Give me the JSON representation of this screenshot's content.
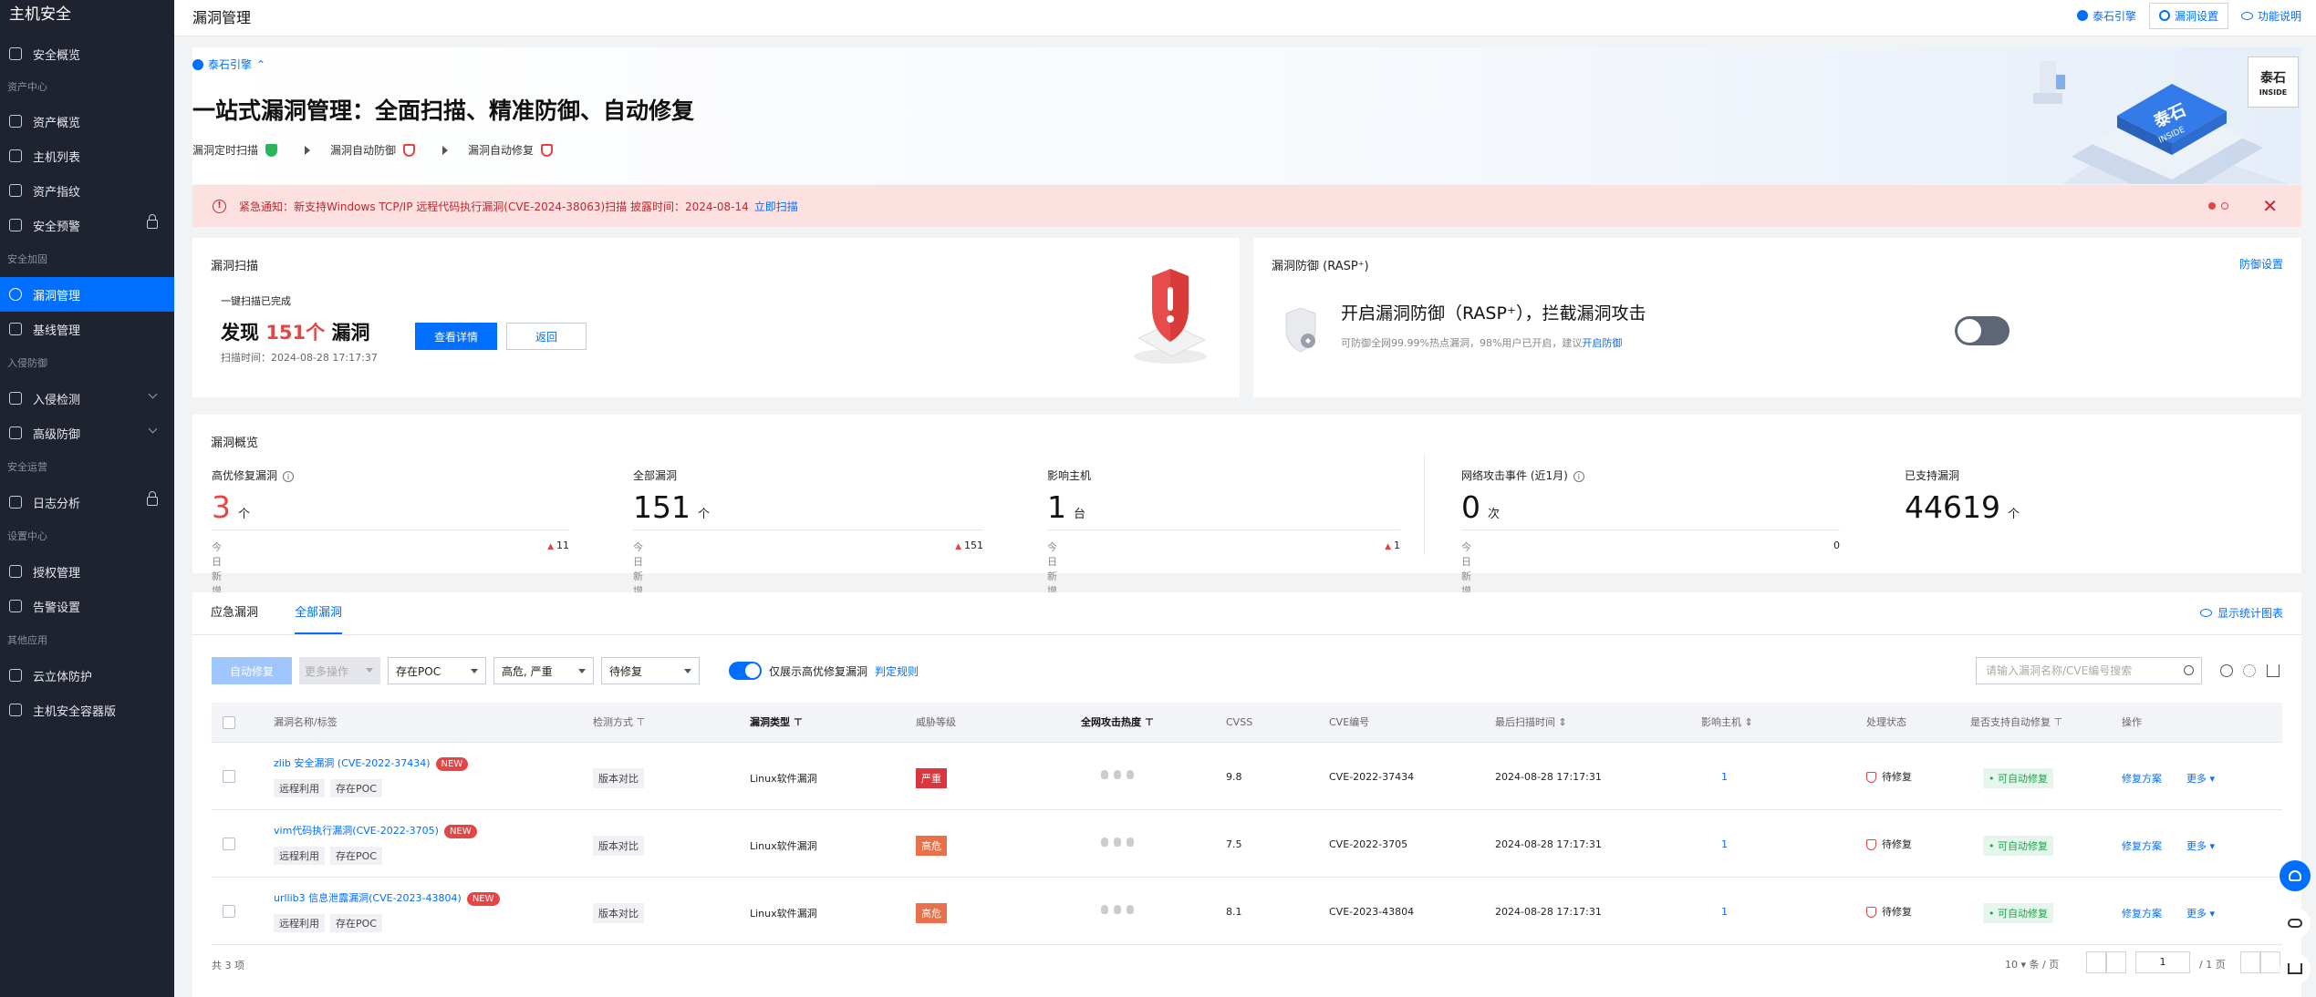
{
  "sidebar": {
    "title": "主机安全",
    "overview": "安全概览",
    "groups": {
      "asset_center": "资产中心",
      "security_hardening": "安全加固",
      "intrusion_defense": "入侵防御",
      "security_ops": "安全运营",
      "settings_center": "设置中心",
      "other_apps": "其他应用"
    },
    "items": {
      "asset_overview": "资产概览",
      "host_list": "主机列表",
      "asset_fingerprint": "资产指纹",
      "security_alert": "安全预警",
      "vuln_mgmt": "漏洞管理",
      "baseline_mgmt": "基线管理",
      "intrusion_detect": "入侵检测",
      "advanced_defense": "高级防御",
      "log_analysis": "日志分析",
      "license_mgmt": "授权管理",
      "alarm_settings": "告警设置",
      "cloud_firewall": "云立体防护",
      "container_security": "主机安全容器版"
    }
  },
  "header": {
    "title": "漏洞管理",
    "engine_link": "泰石引擎",
    "settings_btn": "漏洞设置",
    "help_link": "功能说明"
  },
  "hero": {
    "brand": "泰石引擎",
    "headline": "一站式漏洞管理：全面扫描、精准防御、自动修复",
    "steps": [
      "漏洞定时扫描",
      "漏洞自动防御",
      "漏洞自动修复"
    ],
    "logo_text": "泰石",
    "logo_sub": "INSIDE",
    "art_label_1": "泰石",
    "art_label_2": "INSIDE"
  },
  "alert": {
    "text": "紧急通知：新支持Windows TCP/IP 远程代码执行漏洞(CVE-2024-38063)扫描 披露时间：2024-08-14",
    "action": "立即扫描",
    "close": "✕"
  },
  "scan_card": {
    "title": "漏洞扫描",
    "subtitle": "一键扫描已完成",
    "found_prefix": "发现",
    "found_count": "151个",
    "found_suffix": "漏洞",
    "scan_time": "扫描时间：2024-08-28 17:17:37",
    "detail_btn": "查看详情",
    "back_btn": "返回"
  },
  "rasp_card": {
    "title": "漏洞防御 (RASP⁺)",
    "setting_link": "防御设置",
    "headline": "开启漏洞防御（RASP⁺），拦截漏洞攻击",
    "desc": "可防御全网99.99%热点漏洞，98%用户已开启，建议",
    "desc_link": "开启防御",
    "toggle_on": false
  },
  "overview": {
    "title": "漏洞概览",
    "today_label": "今日新增",
    "stats": [
      {
        "label": "高优修复漏洞",
        "value": "3",
        "unit": "个",
        "delta": "11",
        "delta_up": true
      },
      {
        "label": "全部漏洞",
        "value": "151",
        "unit": "个",
        "delta": "151",
        "delta_up": true
      },
      {
        "label": "影响主机",
        "value": "1",
        "unit": "台",
        "delta": "1",
        "delta_up": true
      },
      {
        "label": "网络攻击事件 (近1月)",
        "value": "0",
        "unit": "次",
        "delta": "0",
        "delta_up": false
      },
      {
        "label": "已支持漏洞",
        "value": "44619",
        "unit": "个"
      }
    ]
  },
  "table_section": {
    "tabs": [
      "应急漏洞",
      "全部漏洞"
    ],
    "active_tab": 1,
    "show_chart": "显示统计图表",
    "toolbar": {
      "auto_fix": "自动修复",
      "more_ops": "更多操作",
      "filter_poc": "存在POC",
      "filter_level": "高危, 严重",
      "filter_status": "待修复",
      "only_high_label": "仅展示高优修复漏洞",
      "rule_link": "判定规则",
      "search_placeholder": "请输入漏洞名称/CVE编号搜索"
    },
    "columns": {
      "name": "漏洞名称/标签",
      "method": "检测方式",
      "type": "漏洞类型",
      "level": "威胁等级",
      "heat": "全网攻击热度",
      "cvss": "CVSS",
      "cve": "CVE编号",
      "last_scan": "最后扫描时间",
      "hosts": "影响主机",
      "status": "处理状态",
      "auto_fix": "是否支持自动修复",
      "ops": "操作"
    },
    "rows": [
      {
        "name": "zlib 安全漏洞 (CVE-2022-37434)",
        "new": "NEW",
        "tags": [
          "远程利用",
          "存在POC"
        ],
        "method": "版本对比",
        "type": "Linux软件漏洞",
        "level": "严重",
        "level_color": "#d9363e",
        "cvss": "9.8",
        "cve": "CVE-2022-37434",
        "last_scan": "2024-08-28 17:17:31",
        "hosts": "1",
        "status": "待修复",
        "auto": "• 可自动修复",
        "fix": "修复方案",
        "more": "更多 ▾"
      },
      {
        "name": "vim代码执行漏洞(CVE-2022-3705)",
        "new": "NEW",
        "tags": [
          "远程利用",
          "存在POC"
        ],
        "method": "版本对比",
        "type": "Linux软件漏洞",
        "level": "高危",
        "level_color": "#e8704a",
        "cvss": "7.5",
        "cve": "CVE-2022-3705",
        "last_scan": "2024-08-28 17:17:31",
        "hosts": "1",
        "status": "待修复",
        "auto": "• 可自动修复",
        "fix": "修复方案",
        "more": "更多 ▾"
      },
      {
        "name": "urllib3 信息泄露漏洞(CVE-2023-43804)",
        "new": "NEW",
        "tags": [
          "远程利用",
          "存在POC"
        ],
        "method": "版本对比",
        "type": "Linux软件漏洞",
        "level": "高危",
        "level_color": "#e8704a",
        "cvss": "8.1",
        "cve": "CVE-2023-43804",
        "last_scan": "2024-08-28 17:17:31",
        "hosts": "1",
        "status": "待修复",
        "auto": "• 可自动修复",
        "fix": "修复方案",
        "more": "更多 ▾"
      }
    ],
    "total": "共 3 项",
    "page_size": "10",
    "page_size_unit": "条 / 页",
    "page_current": "1",
    "page_total": "/ 1 页"
  }
}
